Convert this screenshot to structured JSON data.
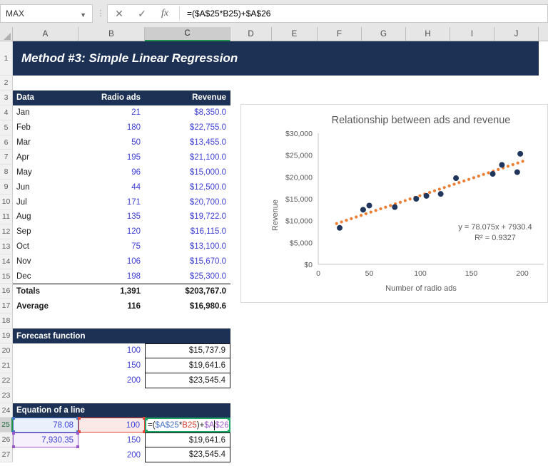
{
  "formula_bar": {
    "name_box": "MAX",
    "cancel_icon": "✕",
    "enter_icon": "✓",
    "fx_icon": "fx",
    "formula": "=($A$25*B25)+$A$26"
  },
  "columns": [
    "A",
    "B",
    "C",
    "D",
    "E",
    "F",
    "G",
    "H",
    "I",
    "J"
  ],
  "row_numbers": [
    "1",
    "2",
    "3",
    "4",
    "5",
    "6",
    "7",
    "8",
    "9",
    "10",
    "11",
    "12",
    "13",
    "14",
    "15",
    "16",
    "17",
    "18",
    "19",
    "20",
    "21",
    "22",
    "23",
    "24",
    "25",
    "26",
    "27"
  ],
  "title_banner": "Method #3: Simple Linear Regression",
  "data_table": {
    "headers": {
      "a": "Data",
      "b": "Radio ads",
      "c": "Revenue"
    },
    "rows": [
      {
        "month": "Jan",
        "ads": "21",
        "revenue": "$8,350.0"
      },
      {
        "month": "Feb",
        "ads": "180",
        "revenue": "$22,755.0"
      },
      {
        "month": "Mar",
        "ads": "50",
        "revenue": "$13,455.0"
      },
      {
        "month": "Apr",
        "ads": "195",
        "revenue": "$21,100.0"
      },
      {
        "month": "May",
        "ads": "96",
        "revenue": "$15,000.0"
      },
      {
        "month": "Jun",
        "ads": "44",
        "revenue": "$12,500.0"
      },
      {
        "month": "Jul",
        "ads": "171",
        "revenue": "$20,700.0"
      },
      {
        "month": "Aug",
        "ads": "135",
        "revenue": "$19,722.0"
      },
      {
        "month": "Sep",
        "ads": "120",
        "revenue": "$16,115.0"
      },
      {
        "month": "Oct",
        "ads": "75",
        "revenue": "$13,100.0"
      },
      {
        "month": "Nov",
        "ads": "106",
        "revenue": "$15,670.0"
      },
      {
        "month": "Dec",
        "ads": "198",
        "revenue": "$25,300.0"
      }
    ],
    "totals": {
      "label": "Totals",
      "ads": "1,391",
      "revenue": "$203,767.0"
    },
    "average": {
      "label": "Average",
      "ads": "116",
      "revenue": "$16,980.6"
    }
  },
  "forecast": {
    "title": "Forecast function",
    "rows": [
      {
        "ads": "100",
        "value": "$15,737.9"
      },
      {
        "ads": "150",
        "value": "$19,641.6"
      },
      {
        "ads": "200",
        "value": "$23,545.4"
      }
    ]
  },
  "equation": {
    "title": "Equation of a line",
    "slope_cell": "78.08",
    "intercept_cell": "7,930.35",
    "rows": [
      {
        "ads": "100"
      },
      {
        "ads": "150",
        "value": "$19,641.6"
      },
      {
        "ads": "200",
        "value": "$23,545.4"
      }
    ],
    "formula_parts": [
      {
        "t": "=(",
        "c": "#1a1a1a"
      },
      {
        "t": "$A$25",
        "c": "#4472c4"
      },
      {
        "t": "*",
        "c": "#1a1a1a"
      },
      {
        "t": "B25",
        "c": "#d63a2e"
      },
      {
        "t": ")",
        "c": "#1a1a1a"
      },
      {
        "t": "+",
        "c": "#1a1a1a"
      },
      {
        "t": "$A",
        "c": "#9b58c8"
      },
      {
        "t": "CURSOR"
      },
      {
        "t": "$26",
        "c": "#9b58c8"
      }
    ],
    "highlights": {
      "slope": {
        "border": "#4472c4",
        "fill": "#ebf1fc"
      },
      "ads": {
        "border": "#e0453a",
        "fill": "#fbe9e8"
      },
      "intercept": {
        "border": "#9b58c8",
        "fill": "#f5f0fb"
      }
    }
  },
  "chart_data": {
    "type": "scatter",
    "title": "Relationship between ads and revenue",
    "xlabel": "Number of radio ads",
    "ylabel": "Revenue",
    "xlim": [
      0,
      220
    ],
    "xtick_step": 50,
    "ylim": [
      0,
      30000
    ],
    "ytick_step": 5000,
    "ytick_labels": [
      "$0",
      "$5,000",
      "$10,000",
      "$15,000",
      "$20,000",
      "$25,000",
      "$30,000"
    ],
    "xtick_labels": [
      "0",
      "50",
      "100",
      "150",
      "200"
    ],
    "grid": false,
    "points": [
      {
        "x": 21,
        "y": 8350
      },
      {
        "x": 180,
        "y": 22755
      },
      {
        "x": 50,
        "y": 13455
      },
      {
        "x": 195,
        "y": 21100
      },
      {
        "x": 96,
        "y": 15000
      },
      {
        "x": 44,
        "y": 12500
      },
      {
        "x": 171,
        "y": 20700
      },
      {
        "x": 135,
        "y": 19722
      },
      {
        "x": 120,
        "y": 16115
      },
      {
        "x": 75,
        "y": 13100
      },
      {
        "x": 106,
        "y": 15670
      },
      {
        "x": 198,
        "y": 25300
      }
    ],
    "trendline": {
      "slope": 78.075,
      "intercept": 7930.4,
      "x_start": 18,
      "x_end": 204,
      "style": "dotted",
      "color": "#ed7d31"
    },
    "equation_label": "y = 78.075x + 7930.4",
    "r2_label": "R² = 0.9327",
    "point_color": "#21365c",
    "text_color": "#595959"
  },
  "colors": {
    "band_navy": "#1c3154",
    "value_blue": "#3f41d6",
    "edit_green": "#21a366"
  }
}
